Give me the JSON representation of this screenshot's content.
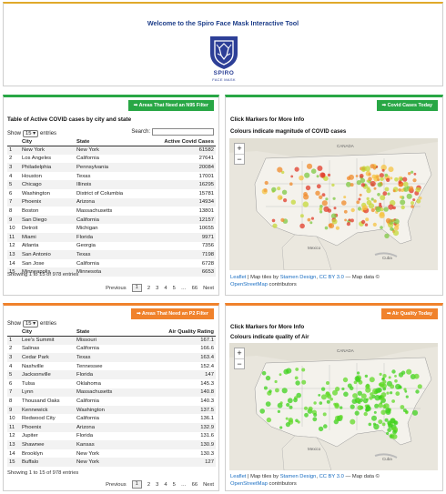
{
  "header": {
    "title": "Welcome to the Spiro Face Mask Interactive Tool",
    "logo_word": "SPIRO",
    "logo_sub": "FACE MASK"
  },
  "covid_table": {
    "badge": "Areas That Need an N95 Filter",
    "caption": "Table of Active COVID cases by city and state",
    "show_label": "Show",
    "show_value": "15",
    "entries_label": "entries",
    "search_label": "Search:",
    "columns": [
      "",
      "City",
      "State",
      "Active Covid Cases"
    ],
    "rows": [
      [
        "1",
        "New York",
        "New York",
        "61582"
      ],
      [
        "2",
        "Los Angeles",
        "California",
        "27641"
      ],
      [
        "3",
        "Philadelphia",
        "Pennsylvania",
        "20084"
      ],
      [
        "4",
        "Houston",
        "Texas",
        "17001"
      ],
      [
        "5",
        "Chicago",
        "Illinois",
        "16295"
      ],
      [
        "6",
        "Washington",
        "District of Columbia",
        "15781"
      ],
      [
        "7",
        "Phoenix",
        "Arizona",
        "14934"
      ],
      [
        "8",
        "Boston",
        "Massachusetts",
        "13801"
      ],
      [
        "9",
        "San Diego",
        "California",
        "12157"
      ],
      [
        "10",
        "Detroit",
        "Michigan",
        "10655"
      ],
      [
        "11",
        "Miami",
        "Florida",
        "9971"
      ],
      [
        "12",
        "Atlanta",
        "Georgia",
        "7356"
      ],
      [
        "13",
        "San Antonio",
        "Texas",
        "7198"
      ],
      [
        "14",
        "San Jose",
        "California",
        "6728"
      ],
      [
        "15",
        "Minneapolis",
        "Minnesota",
        "6653"
      ]
    ],
    "info": "Showing 1 to 15 of 978 entries",
    "pager": {
      "previous": "Previous",
      "pages": [
        "1",
        "2",
        "3",
        "4",
        "5",
        "…",
        "66"
      ],
      "next": "Next"
    }
  },
  "covid_map": {
    "badge": "Covid Cases Today",
    "title": "Click Markers for More Info",
    "subtitle": "Colours indicate magnitude of COVID cases",
    "zoom_in": "+",
    "zoom_out": "−",
    "attribution": {
      "leaflet": "Leaflet",
      "mid": " | Map tiles by ",
      "stamen": "Stamen Design",
      "sep": ", ",
      "license": "CC BY 3.0",
      "data": " — Map data ©",
      "osm": "OpenStreetMap",
      "contributors": " contributors"
    },
    "labels": {
      "canada": "CANADA",
      "mexico": "Mexico",
      "cuba": "Cuba"
    },
    "marker_colors": [
      "#e23b2a",
      "#f08a2a",
      "#f5c341",
      "#c6d83a",
      "#7fc843"
    ]
  },
  "air_table": {
    "badge": "Areas That Need an P2 Filter",
    "show_label": "Show",
    "show_value": "15",
    "entries_label": "entries",
    "columns": [
      "",
      "City",
      "State",
      "Air Quality Rating"
    ],
    "rows": [
      [
        "1",
        "Lee's Summit",
        "Missouri",
        "167.1"
      ],
      [
        "2",
        "Salinas",
        "California",
        "166.6"
      ],
      [
        "3",
        "Cedar Park",
        "Texas",
        "163.4"
      ],
      [
        "4",
        "Nashville",
        "Tennessee",
        "152.4"
      ],
      [
        "5",
        "Jacksonville",
        "Florida",
        "147"
      ],
      [
        "6",
        "Tulsa",
        "Oklahoma",
        "145.3"
      ],
      [
        "7",
        "Lynn",
        "Massachusetts",
        "140.8"
      ],
      [
        "8",
        "Thousand Oaks",
        "California",
        "140.3"
      ],
      [
        "9",
        "Kennewick",
        "Washington",
        "137.5"
      ],
      [
        "10",
        "Redwood City",
        "California",
        "136.1"
      ],
      [
        "11",
        "Phoenix",
        "Arizona",
        "132.9"
      ],
      [
        "12",
        "Jupiter",
        "Florida",
        "131.6"
      ],
      [
        "13",
        "Shawnee",
        "Kansas",
        "130.9"
      ],
      [
        "14",
        "Brooklyn",
        "New York",
        "130.3"
      ],
      [
        "15",
        "Buffalo",
        "New York",
        "127"
      ]
    ],
    "info": "Showing 1 to 15 of 978 entries",
    "pager": {
      "previous": "Previous",
      "pages": [
        "1",
        "2",
        "3",
        "4",
        "5",
        "…",
        "66"
      ],
      "next": "Next"
    }
  },
  "air_map": {
    "badge": "Air Quality Today",
    "title": "Click Markers for More Info",
    "subtitle": "Colours indicate quality of Air",
    "zoom_in": "+",
    "zoom_out": "−",
    "attribution": {
      "leaflet": "Leaflet",
      "mid": " | Map tiles by ",
      "stamen": "Stamen Design",
      "sep": ", ",
      "license": "CC BY 3.0",
      "data": " — Map data ©",
      "osm": "OpenStreetMap",
      "contributors": " contributors"
    },
    "labels": {
      "canada": "CANADA",
      "mexico": "Mexico",
      "cuba": "Cuba"
    },
    "marker_colors": [
      "#3fd11d",
      "#63da2a"
    ]
  }
}
